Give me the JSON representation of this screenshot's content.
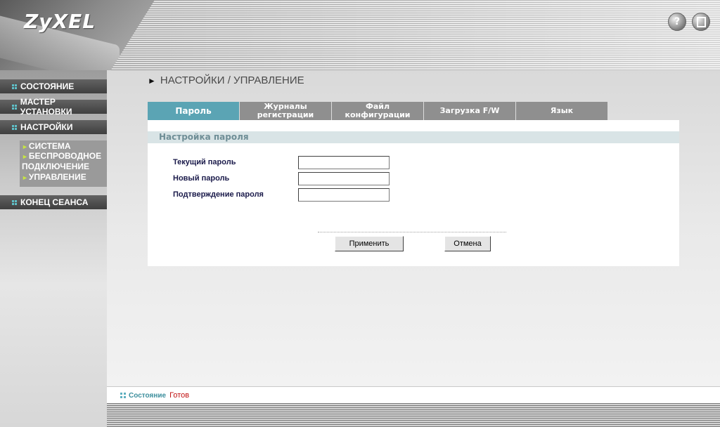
{
  "brand": {
    "logo": "ZyXEL"
  },
  "header": {
    "help_icon": "?",
    "help_icon_name": "help-icon",
    "exit_icon_name": "exit-icon"
  },
  "sidebar": {
    "items": [
      {
        "label": "СОСТОЯНИЕ"
      },
      {
        "label": "МАСТЕР УСТАНОВКИ"
      },
      {
        "label": "НАСТРОЙКИ"
      },
      {
        "label": "КОНЕЦ СЕАНСА"
      }
    ],
    "submenu": [
      {
        "label": "СИСТЕМА"
      },
      {
        "label": "БЕСПРОВОДНОЕ",
        "label2": "ПОДКЛЮЧЕНИЕ"
      },
      {
        "label": "УПРАВЛЕНИЕ"
      }
    ],
    "accent": "#5fc0c8",
    "sub_arrow_color": "#c7e640"
  },
  "main": {
    "title": "НАСТРОЙКИ / УПРАВЛЕНИЕ",
    "tabs": [
      {
        "line1": "Пароль",
        "line2": ""
      },
      {
        "line1": "Журналы",
        "line2": "регистрации"
      },
      {
        "line1": "Файл",
        "line2": "конфигурации"
      },
      {
        "line1": "Загрузка F/W",
        "line2": ""
      },
      {
        "line1": "Язык",
        "line2": ""
      }
    ],
    "active_tab_color": "#5ba4b4",
    "section_title": "Настройка пароля",
    "fields": [
      {
        "label": "Текущий пароль",
        "value": ""
      },
      {
        "label": "Новый пароль",
        "value": ""
      },
      {
        "label": "Подтверждение пароля",
        "value": ""
      }
    ],
    "buttons": {
      "apply": "Применить",
      "cancel": "Отмена"
    }
  },
  "statusbar": {
    "label": "Состояние",
    "value": "Готов",
    "value_color": "#c01010"
  }
}
